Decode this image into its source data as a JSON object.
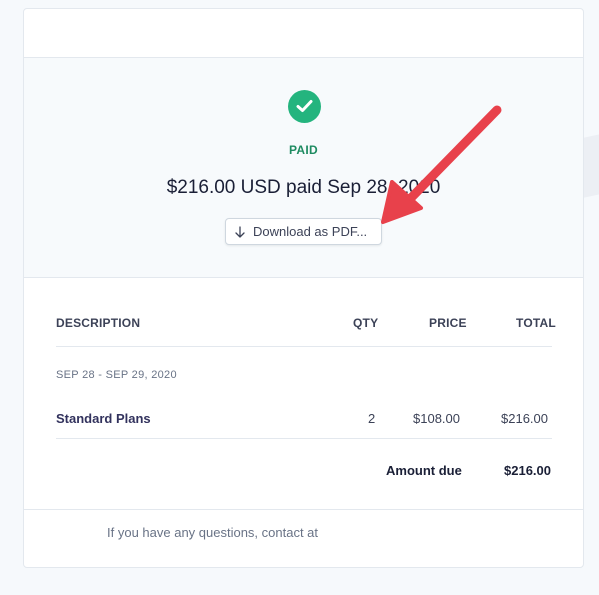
{
  "status": {
    "label": "PAID",
    "check_icon": "check-circle-icon",
    "color": "#24b47e"
  },
  "payment": {
    "summary": "$216.00 USD paid Sep 28, 2020"
  },
  "download": {
    "label": "Download as PDF...",
    "icon": "arrow-down-icon"
  },
  "table": {
    "headers": {
      "description": "DESCRIPTION",
      "qty": "QTY",
      "price": "PRICE",
      "total": "TOTAL"
    },
    "period": "SEP 28 - SEP 29, 2020",
    "rows": [
      {
        "description": "Standard Plans",
        "qty": "2",
        "price": "$108.00",
        "total": "$216.00"
      }
    ],
    "amount_due_label": "Amount due",
    "amount_due_value": "$216.00"
  },
  "footer": {
    "text": "If you have any questions, contact at"
  },
  "annotation": {
    "arrow_color": "#e8414b"
  }
}
